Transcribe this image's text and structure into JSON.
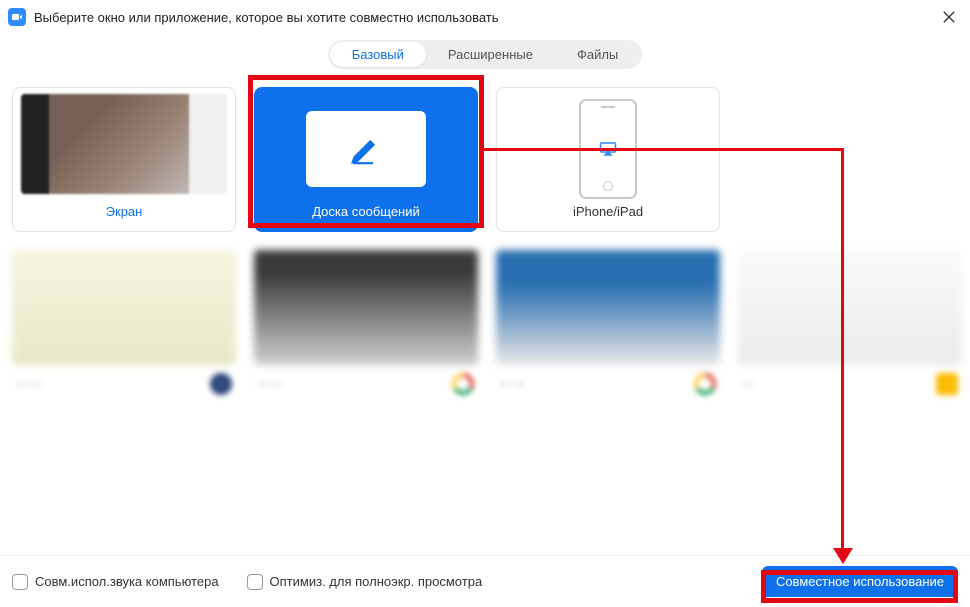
{
  "header": {
    "title": "Выберите окно или приложение, которое вы хотите совместно использовать",
    "close_icon": "close"
  },
  "tabs": {
    "items": [
      {
        "label": "Базовый",
        "active": true
      },
      {
        "label": "Расширенные",
        "active": false
      },
      {
        "label": "Файлы",
        "active": false
      }
    ]
  },
  "options": {
    "screen": {
      "label": "Экран"
    },
    "whiteboard": {
      "label": "Доска сообщений"
    },
    "iphone": {
      "label": "iPhone/iPad"
    }
  },
  "footer": {
    "share_audio_label": "Совм.испол.звука компьютера",
    "optimize_label": "Оптимиз. для полноэкр. просмотра",
    "share_button_label": "Совместное использование"
  },
  "colors": {
    "accent": "#0e71eb",
    "annotation": "#e30613"
  }
}
